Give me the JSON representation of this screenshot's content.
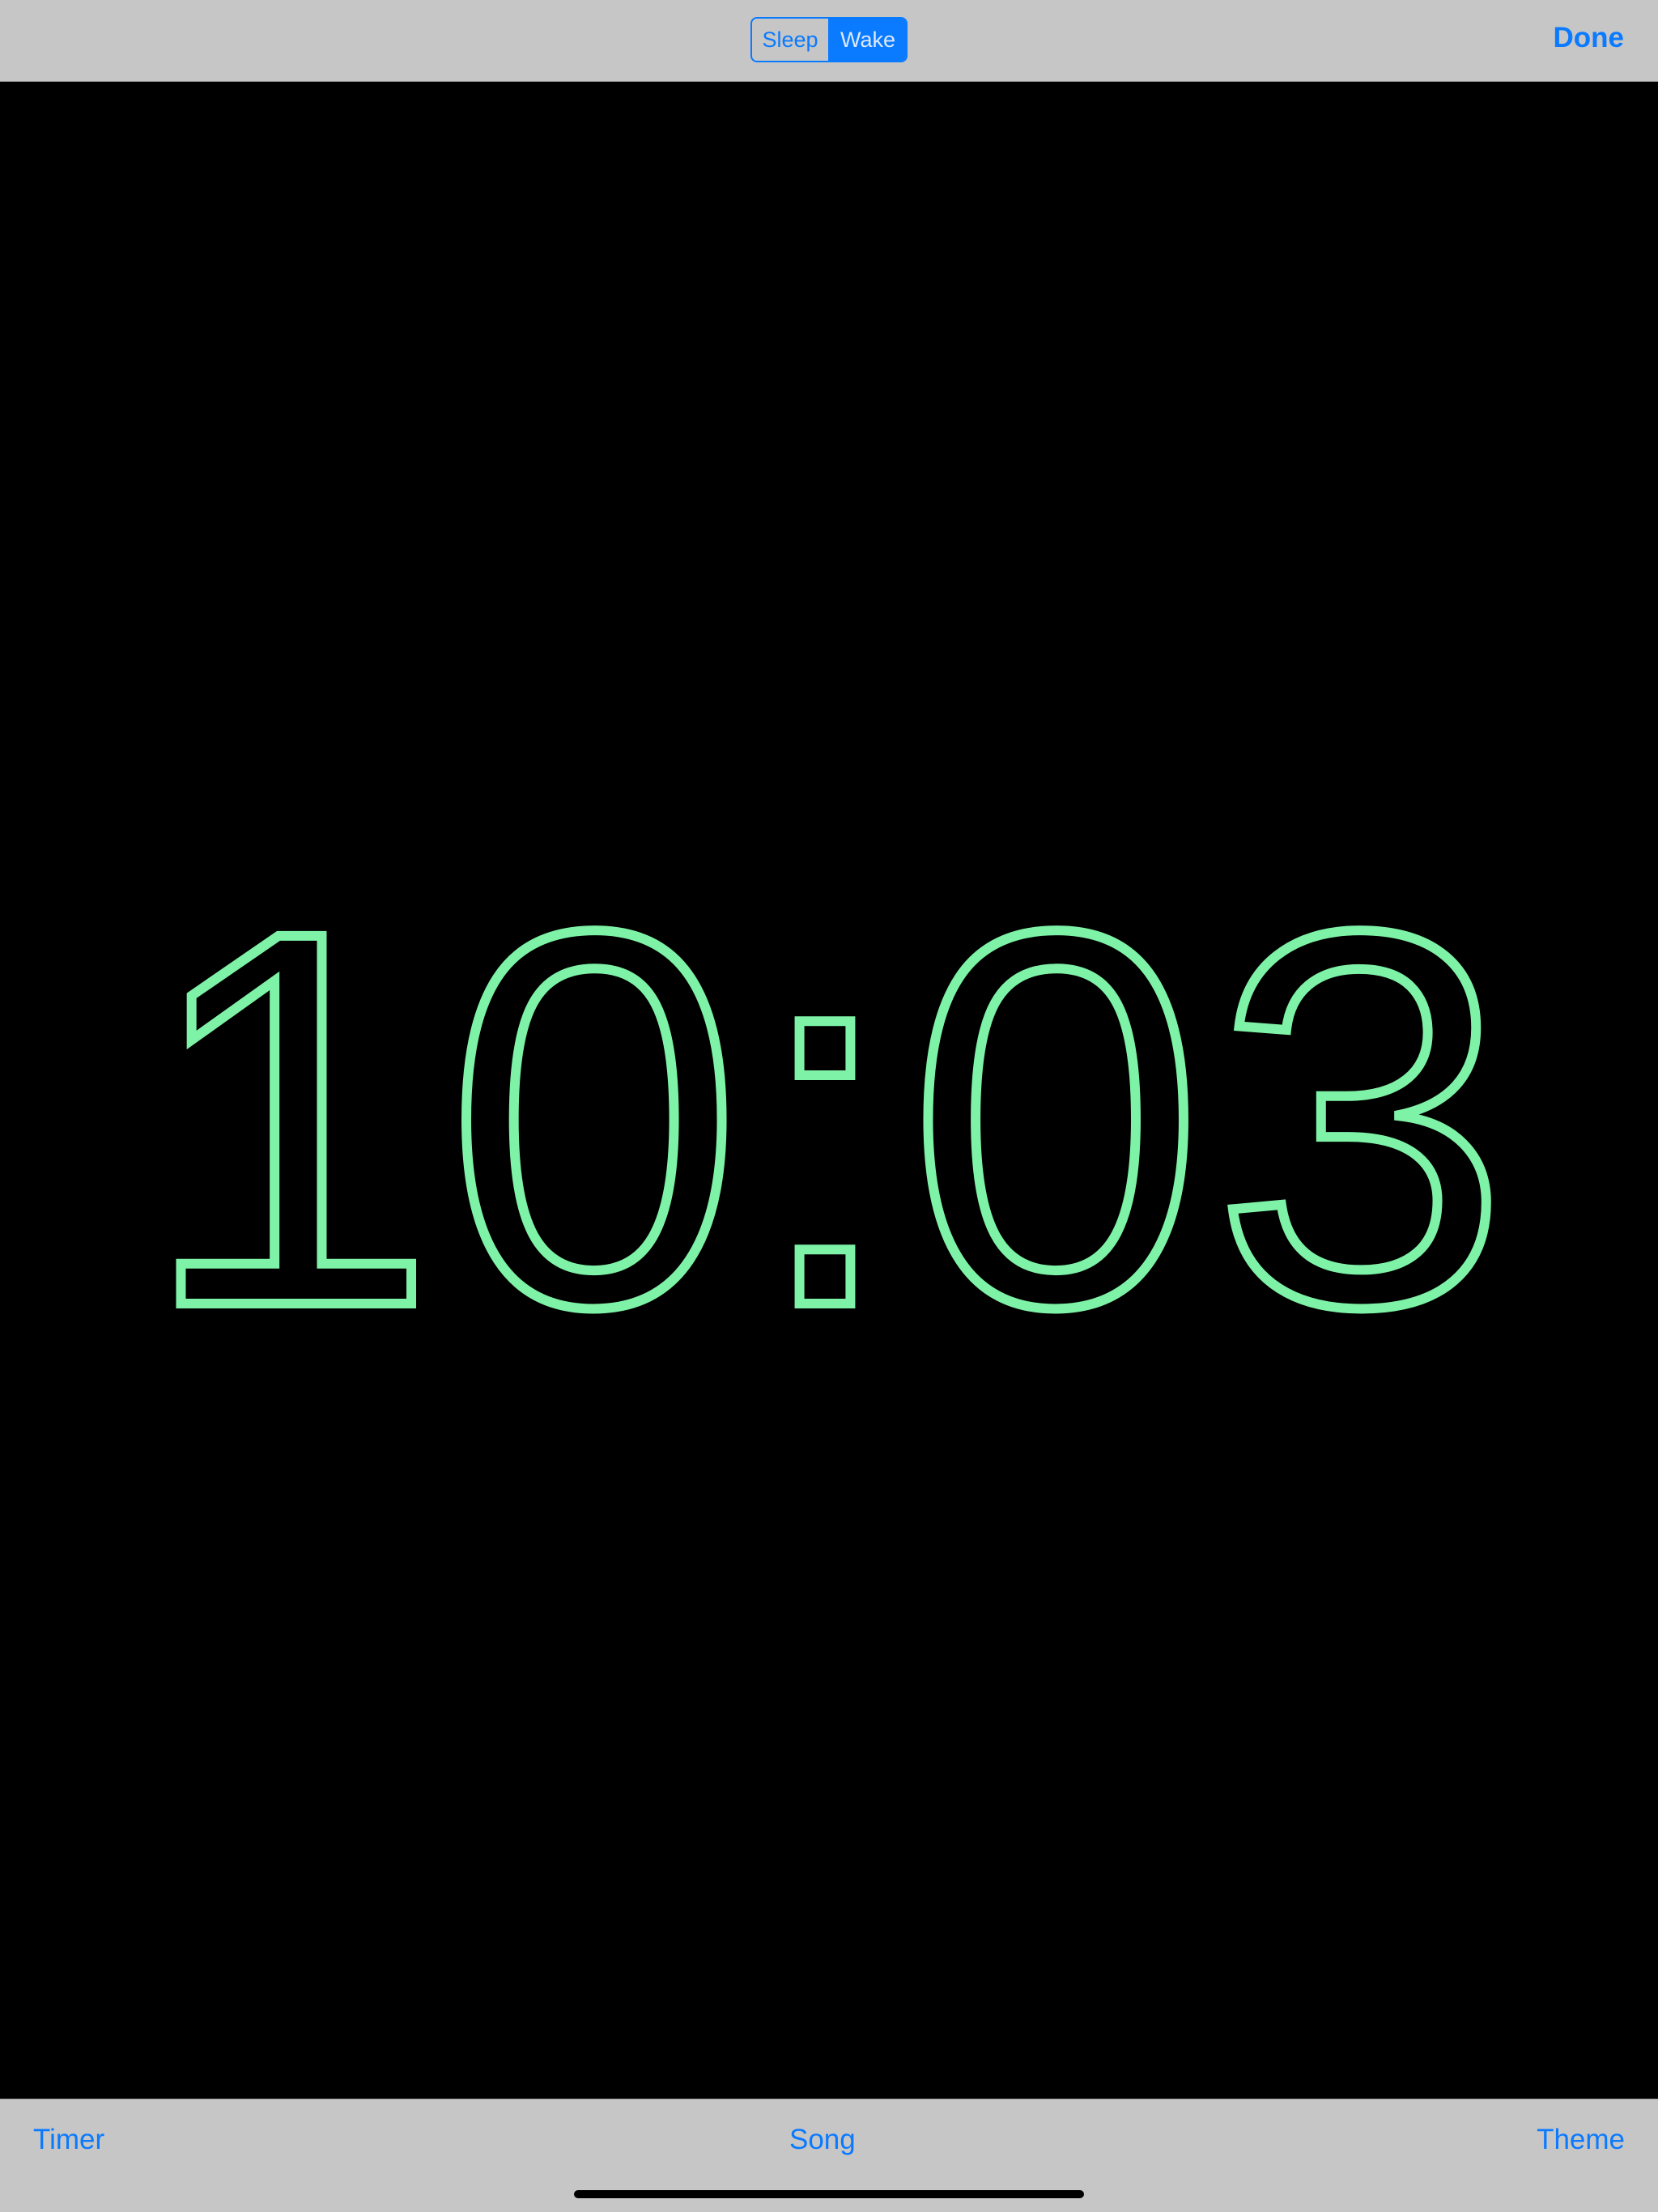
{
  "header": {
    "mode_options": [
      "Sleep",
      "Wake"
    ],
    "selected_mode": "Wake",
    "done_label": "Done"
  },
  "clock": {
    "time": "10:03",
    "digit_color": "#7ef2a6"
  },
  "toolbar": {
    "timer_label": "Timer",
    "song_label": "Song",
    "theme_label": "Theme"
  },
  "colors": {
    "accent": "#0a7aff",
    "bar_background": "#c6c6c6",
    "screen_background": "#000000"
  }
}
